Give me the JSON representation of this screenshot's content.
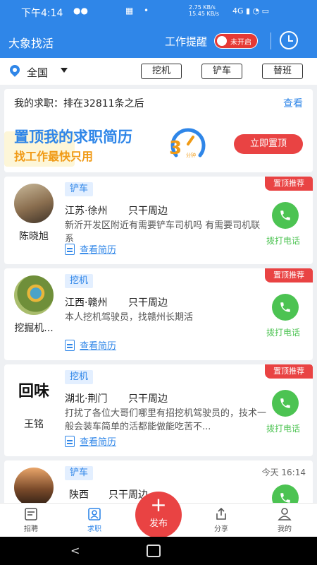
{
  "status_bar": {
    "time": "下午4:14",
    "net_up": "2.75 KB/s",
    "net_down": "15.45 KB/s",
    "signal": "4G"
  },
  "app_bar": {
    "title": "大象找活",
    "remind_label": "工作提醒",
    "toggle_label": "未开启"
  },
  "filter": {
    "region": "全国",
    "chips": [
      "挖机",
      "铲车",
      "替班"
    ]
  },
  "promo": {
    "rank_text": "我的求职：排在32811条之后",
    "view_label": "查看",
    "headline": "置顶我的求职简历",
    "subline": "找工作最快只用",
    "timer_number": "3",
    "timer_unit": "分钟",
    "cta_label": "立即置顶"
  },
  "cards": [
    {
      "name": "陈晓旭",
      "category": "铲车",
      "location": "江苏·徐州",
      "scope": "只干周边",
      "description": "新沂开发区附近有需要铲车司机吗 有需要司机联系",
      "resume_label": "查看简历",
      "badge": "置顶推荐",
      "call_label": "拨打电话"
    },
    {
      "name": "挖掘机...",
      "category": "挖机",
      "location": "江西·赣州",
      "scope": "只干周边",
      "description": "本人挖机驾驶员，找赣州长期活",
      "resume_label": "查看简历",
      "badge": "置顶推荐",
      "call_label": "拨打电话"
    },
    {
      "name": "王铭",
      "category": "挖机",
      "location": "湖北·荆门",
      "scope": "只干周边",
      "description": "打扰了各位大哥们哪里有招挖机驾驶员的，技术一般会装车简单的活都能做能吃苦不...",
      "resume_label": "查看简历",
      "badge": "置顶推荐",
      "call_label": "拨打电话",
      "avatar_text": "回味"
    },
    {
      "name": "",
      "category": "铲车",
      "location": "陕西",
      "scope": "只干周边",
      "time": "今天 16:14"
    }
  ],
  "tabs": {
    "recruit": "招聘",
    "seek": "求职",
    "publish": "发布",
    "share": "分享",
    "mine": "我的"
  },
  "colors": {
    "primary": "#2f86e8",
    "danger": "#e94343",
    "call": "#4cc352",
    "highlight": "#f09a15"
  }
}
